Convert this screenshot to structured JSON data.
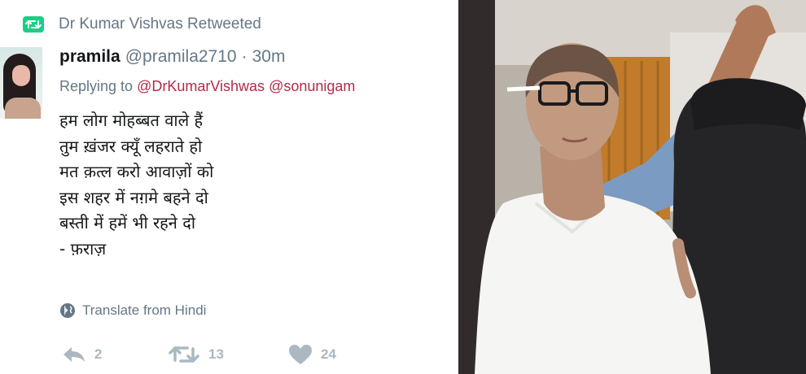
{
  "retweet_header": {
    "icon": "retweet-icon",
    "text": "Dr Kumar Vishvas Retweeted",
    "accent_color": "#19cf86"
  },
  "tweet": {
    "display_name": "pramila",
    "handle": "@pramila2710",
    "separator": "·",
    "timestamp": "30m",
    "replying_prefix": "Replying to",
    "replying_mentions": [
      "@DrKumarVishwas",
      "@sonunigam"
    ],
    "text_lines": [
      "हम लोग मोहब्बत वाले हैं",
      "तुम ख़ंजर क्यूँ लहराते हो",
      "मत क़त्ल करो आवाज़ों को",
      "इस शहर में नग़मे बहने दो",
      "बस्ती में हमें भी रहने दो",
      "- फ़राज़"
    ],
    "translate_label": "Translate from Hindi",
    "translate_icon": "globe-icon"
  },
  "actions": {
    "reply_icon": "reply-icon",
    "reply_count": "2",
    "retweet_icon": "retweet-icon",
    "retweet_count": "13",
    "like_icon": "heart-icon",
    "like_count": "24"
  },
  "media": {
    "description_icon": "photo",
    "colors": {
      "mention": "#b5294a",
      "muted": "#657786",
      "action": "#aab8c2"
    }
  }
}
